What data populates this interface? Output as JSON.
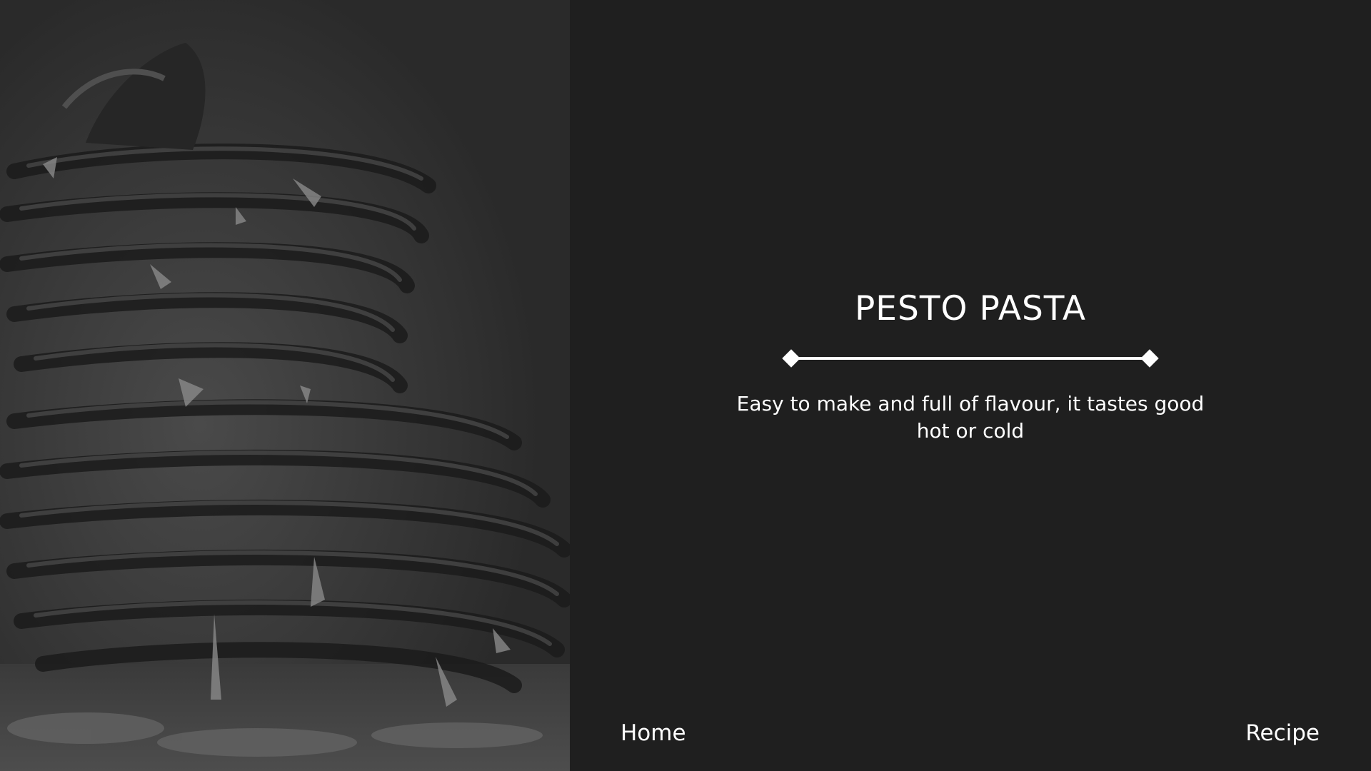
{
  "hero": {
    "image_alt": "pesto pasta",
    "title": "PESTO PASTA",
    "subtitle": "Easy to make and full of flavour, it tastes good hot or cold"
  },
  "nav": {
    "home_label": "Home",
    "recipe_label": "Recipe"
  },
  "colors": {
    "background": "#1f1f1f",
    "text": "#ffffff"
  }
}
